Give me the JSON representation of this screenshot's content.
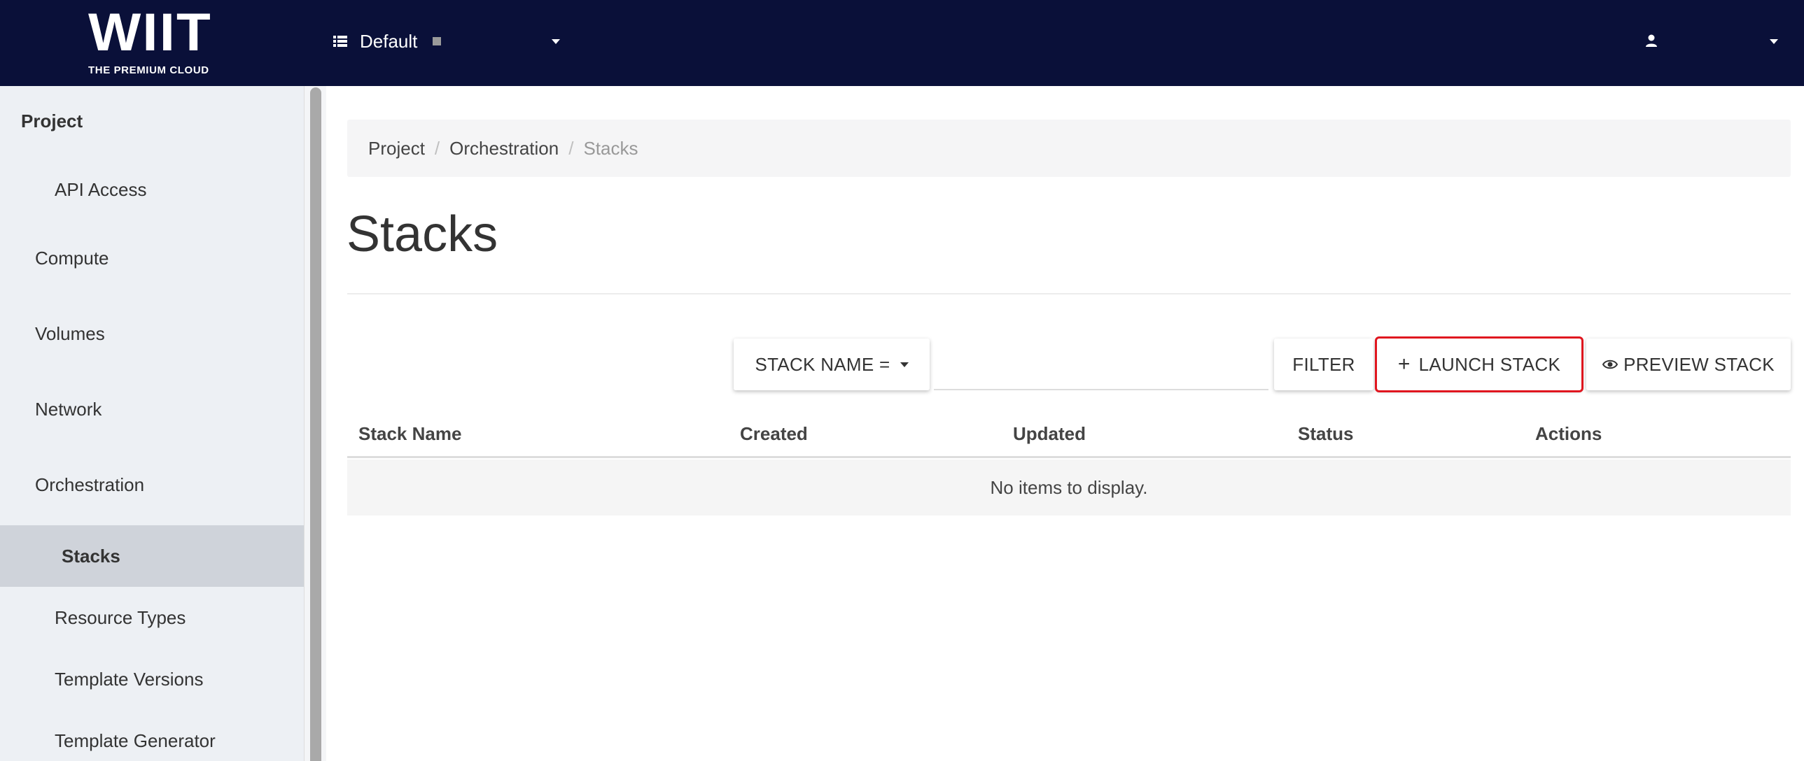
{
  "brand": {
    "name": "WIIT",
    "tagline": "THE PREMIUM CLOUD"
  },
  "navbar": {
    "project_label": "Default",
    "project_icon": "list-icon",
    "user_icon": "user-icon"
  },
  "sidebar": {
    "items": [
      {
        "label": "Project",
        "kind": "heading"
      },
      {
        "label": "API Access",
        "kind": "sub"
      },
      {
        "label": "Compute",
        "kind": "group"
      },
      {
        "label": "Volumes",
        "kind": "group"
      },
      {
        "label": "Network",
        "kind": "group"
      },
      {
        "label": "Orchestration",
        "kind": "group"
      },
      {
        "label": "Stacks",
        "kind": "active"
      },
      {
        "label": "Resource Types",
        "kind": "sub"
      },
      {
        "label": "Template Versions",
        "kind": "sub"
      },
      {
        "label": "Template Generator",
        "kind": "sub"
      }
    ]
  },
  "breadcrumb": [
    "Project",
    "Orchestration",
    "Stacks"
  ],
  "page": {
    "title": "Stacks"
  },
  "toolbar": {
    "filter_field": "STACK NAME =",
    "filter_value": "",
    "filter_button": "FILTER",
    "launch_button": "LAUNCH STACK",
    "launch_plus": "+",
    "preview_button": "PREVIEW STACK",
    "highlight_color": "#e0161f"
  },
  "table": {
    "columns": [
      "Stack Name",
      "Created",
      "Updated",
      "Status",
      "Actions"
    ],
    "empty_message": "No items to display."
  },
  "colors": {
    "navbar_bg": "#0a1039",
    "sidebar_bg": "#edf0f4",
    "sidebar_active_bg": "#cfd3da"
  }
}
